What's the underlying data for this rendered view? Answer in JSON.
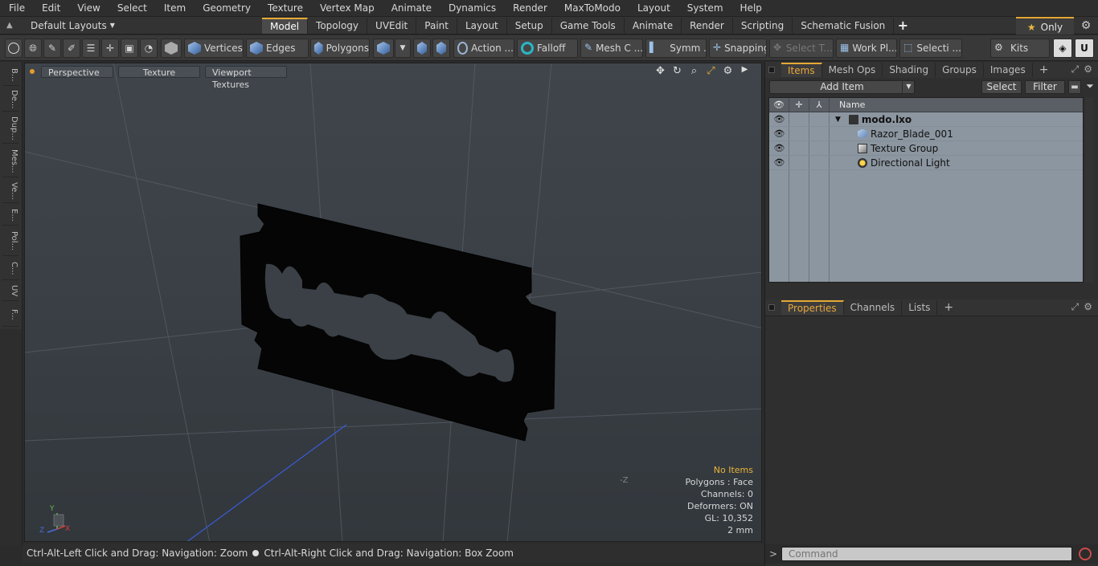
{
  "menu": [
    "File",
    "Edit",
    "View",
    "Select",
    "Item",
    "Geometry",
    "Texture",
    "Vertex Map",
    "Animate",
    "Dynamics",
    "Render",
    "MaxToModo",
    "Layout",
    "System",
    "Help"
  ],
  "layout": {
    "name": "Default Layouts",
    "tabs": [
      "Model",
      "Topology",
      "UVEdit",
      "Paint",
      "Layout",
      "Setup",
      "Game Tools",
      "Animate",
      "Render",
      "Scripting",
      "Schematic Fusion"
    ],
    "active_tab": "Model",
    "add_label": "+",
    "only_label": "Only"
  },
  "toolbar": {
    "vertices": "Vertices",
    "edges": "Edges",
    "polygons": "Polygons",
    "action": "Action ...",
    "falloff": "Falloff",
    "mesh": "Mesh C ...",
    "symm": "Symm ...",
    "snapping": "Snapping",
    "select_t": "Select T...",
    "work_pl": "Work Pl...",
    "selecti": "Selecti ...",
    "kits": "Kits"
  },
  "left_tabs": [
    "B...",
    "De...",
    "Dup...",
    "Mes...",
    "Ve...",
    "E...",
    "Pol...",
    "C...",
    "UV",
    "F..."
  ],
  "viewport": {
    "view_mode": "Perspective",
    "shading": "Texture",
    "textures": "Viewport Textures",
    "info": {
      "items": "No Items",
      "polygons": "Polygons : Face",
      "channels": "Channels: 0",
      "deformers": "Deformers: ON",
      "gl": "GL: 10,352",
      "scale": "2 mm"
    },
    "axis_label": "-Z",
    "axis_x": "X",
    "axis_y": "Y",
    "axis_z": "Z"
  },
  "status": {
    "left": "Ctrl-Alt-Left Click and Drag: Navigation: Zoom",
    "right": "Ctrl-Alt-Right Click and Drag: Navigation: Box Zoom"
  },
  "items_panel": {
    "tabs": [
      "Items",
      "Mesh Ops",
      "Shading",
      "Groups",
      "Images"
    ],
    "active": "Items",
    "add_item": "Add Item",
    "select": "Select",
    "filter": "Filter",
    "column_name": "Name",
    "tree": [
      {
        "name": "modo.lxo",
        "type": "scene"
      },
      {
        "name": "Razor_Blade_001",
        "type": "mesh"
      },
      {
        "name": "Texture Group",
        "type": "texture"
      },
      {
        "name": "Directional Light",
        "type": "light"
      }
    ]
  },
  "props_panel": {
    "tabs": [
      "Properties",
      "Channels",
      "Lists"
    ],
    "active": "Properties"
  },
  "command": {
    "prompt": ">",
    "placeholder": "Command"
  },
  "colors": {
    "accent": "#e5a835",
    "tree_bg": "#8c96a0",
    "viewport_bg": "#3c4248"
  }
}
